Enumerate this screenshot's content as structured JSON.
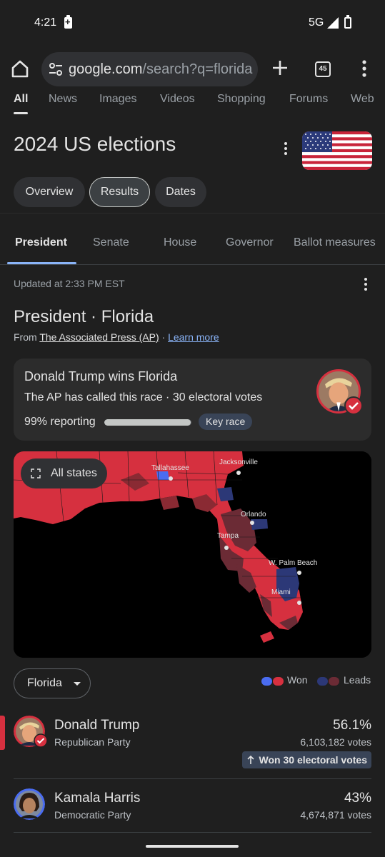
{
  "status_bar": {
    "time": "4:21",
    "network": "5G"
  },
  "browser": {
    "url_host": "google.com",
    "url_rest": "/search?q=florida",
    "tab_count": "45"
  },
  "search_tabs": [
    "All",
    "News",
    "Images",
    "Videos",
    "Shopping",
    "Forums",
    "Web"
  ],
  "topic": {
    "title": "2024 US elections",
    "chips": [
      "Overview",
      "Results",
      "Dates"
    ]
  },
  "race_tabs": [
    "President",
    "Senate",
    "House",
    "Governor",
    "Ballot measures"
  ],
  "race": {
    "updated": "Updated at 2:33 PM EST",
    "title": "President · Florida",
    "from_prefix": "From",
    "source": "The Associated Press (AP)",
    "separator": "·",
    "learn_more": "Learn more"
  },
  "winner_card": {
    "headline": "Donald Trump wins Florida",
    "sub": "The AP has called this race · 30 electoral votes",
    "reporting": "99% reporting",
    "reporting_fraction": 0.99,
    "badge": "Key race"
  },
  "map": {
    "all_states": "All states",
    "cities": [
      "Tallahassee",
      "Jacksonville",
      "Orlando",
      "Tampa",
      "W. Palm Beach",
      "Miami"
    ]
  },
  "filter": {
    "state": "Florida"
  },
  "legend": {
    "won": "Won",
    "leads": "Leads"
  },
  "candidates": [
    {
      "name": "Donald Trump",
      "party": "Republican Party",
      "percent": "56.1%",
      "votes": "6,103,182 votes",
      "electoral": "Won 30 electoral votes"
    },
    {
      "name": "Kamala Harris",
      "party": "Democratic Party",
      "percent": "43%",
      "votes": "4,674,871 votes"
    }
  ],
  "colors": {
    "republican_won": "#d6303f",
    "republican_leads": "#6b2b35",
    "democratic_won": "#4a6cf0",
    "democratic_leads": "#2c3877",
    "accent": "#8ab4f8"
  }
}
